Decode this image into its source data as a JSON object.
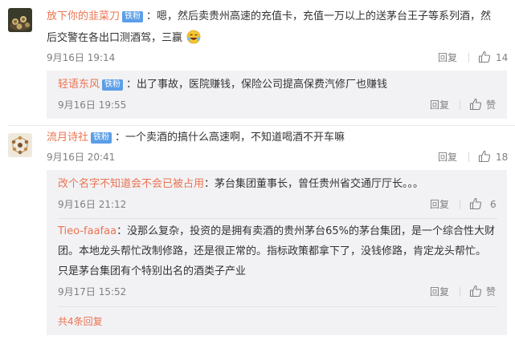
{
  "comments": [
    {
      "user": "放下你的韭菜刀",
      "badge": "铁粉",
      "line1": "：嗯，然后卖贵州高速的充值卡，充值一万以上的送茅台王子等系列酒，然",
      "line2": "后交警在各出口测酒驾，三赢",
      "time": "9月16日 19:14",
      "reply": "回复",
      "likes": "14",
      "avatar_icon": "tea-cups-avatar",
      "emoji_icon": "laughing-emoji",
      "replies": [
        {
          "user": "轻语东风",
          "badge": "铁粉",
          "line1": "：出了事故，医院赚钱，保险公司提高保费汽修厂也赚钱",
          "time": "9月16日 19:55",
          "reply": "回复",
          "likes": "赞"
        }
      ]
    },
    {
      "user": "流月诗社",
      "badge": "铁粉",
      "line1": "：一个卖酒的搞什么高速啊，不知道喝酒不开车嘛",
      "time": "9月16日 20:41",
      "reply": "回复",
      "likes": "18",
      "avatar_icon": "tea-set-avatar",
      "replies": [
        {
          "user": "改个名字不知道会不会已被占用",
          "line1": "：茅台集团董事长，曾任贵州省交通厅厅长。。。",
          "time": "9月16日 21:12",
          "reply": "回复",
          "likes": "6"
        },
        {
          "user": "Tieo-faafaa",
          "line1": "：没那么复杂，投资的是拥有卖酒的贵州茅台65%的茅台集团，是一个综合性大财",
          "line2": "团。本地龙头帮忙改制修路，还是很正常的。指标政策都拿下了，没钱修路，肯定龙头帮忙。",
          "line3": "只是茅台集团有个特别出名的酒类子产业",
          "time": "9月17日 15:52",
          "reply": "回复",
          "likes": "赞"
        }
      ],
      "more_replies": "共4条回复"
    }
  ],
  "colors": {
    "username": "#eb7350",
    "badge": "#5b9ee8",
    "reply_bg": "#f2f2f5",
    "meta": "#808080"
  }
}
